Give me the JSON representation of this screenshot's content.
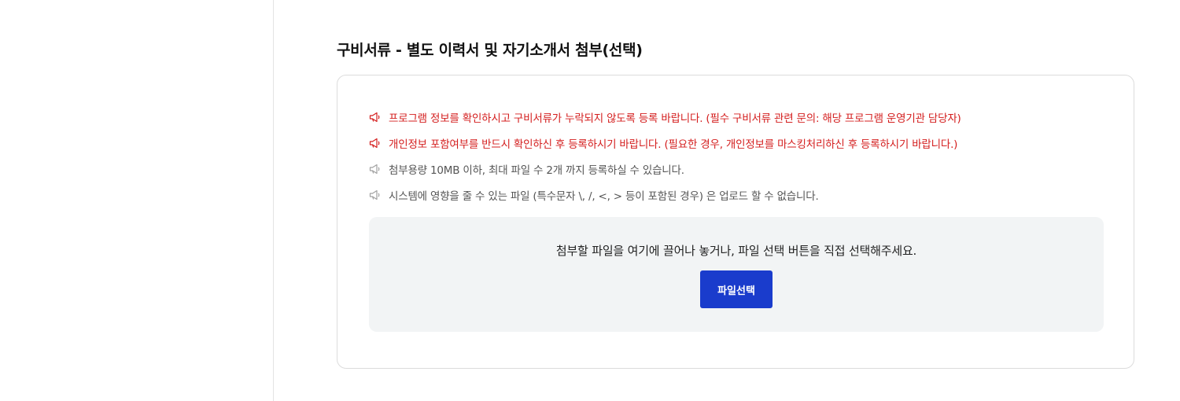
{
  "section": {
    "title": "구비서류 - 별도 이력서 및 자기소개서 첨부(선택)"
  },
  "notices": [
    {
      "text": "프로그램 정보를 확인하시고 구비서류가 누락되지 않도록 등록 바랍니다. (필수 구비서류 관련 문의: 해당 프로그램 운영기관 담당자)",
      "color": "#d41e1e",
      "icon": "megaphone-icon"
    },
    {
      "text": "개인정보 포함여부를 반드시 확인하신 후 등록하시기 바랍니다. (필요한 경우, 개인정보를 마스킹처리하신 후 등록하시기 바랍니다.)",
      "color": "#d41e1e",
      "icon": "megaphone-icon"
    },
    {
      "text": "첨부용량 10MB 이하, 최대 파일 수 2개 까지 등록하실 수 있습니다.",
      "color": "#555555",
      "icon": "megaphone-icon"
    },
    {
      "text": "시스템에 영향을 줄 수 있는 파일 (특수문자 \\, /, <, > 등이 포함된 경우) 은 업로드 할 수 없습니다.",
      "color": "#555555",
      "icon": "megaphone-icon"
    }
  ],
  "dropzone": {
    "text": "첨부할 파일을 여기에 끌어나 놓거나, 파일 선택 버튼을 직접 선택해주세요.",
    "button_label": "파일선택",
    "button_color": "#1a3ccc"
  }
}
